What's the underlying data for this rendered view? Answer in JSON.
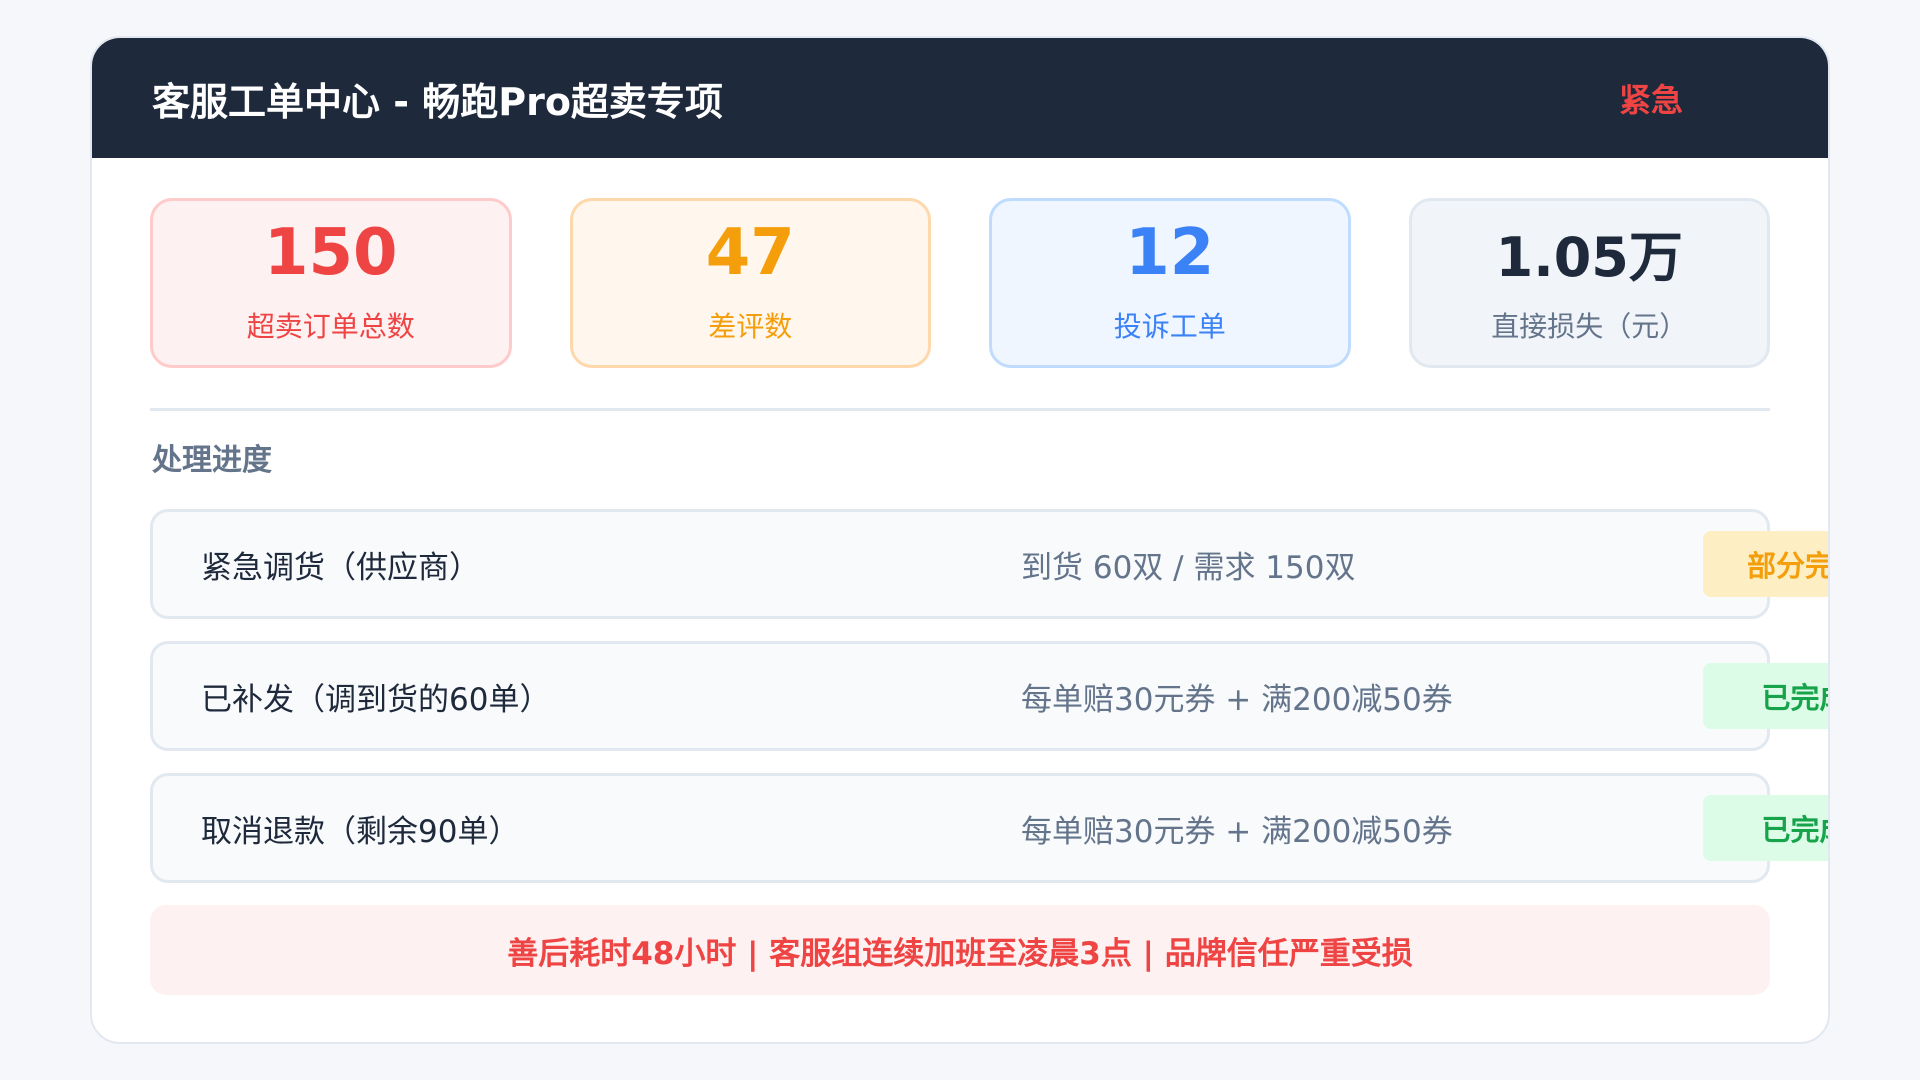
{
  "header": {
    "title": "客服工单中心 - 畅跑Pro超卖专项",
    "badge": "紧急"
  },
  "stats": [
    {
      "value": "150",
      "label": "超卖订单总数",
      "color": "#ef4444"
    },
    {
      "value": "47",
      "label": "差评数",
      "color": "#f59e0b"
    },
    {
      "value": "12",
      "label": "投诉工单",
      "color": "#3b82f6"
    },
    {
      "value": "1.05万",
      "label": "直接损失（元）",
      "color": "#1e293b"
    }
  ],
  "progress": {
    "title": "处理进度",
    "rows": [
      {
        "name": "紧急调货（供应商）",
        "detail": "到货 60双 / 需求 150双",
        "status": "部分完成",
        "status_color": "#f59e0b"
      },
      {
        "name": "已补发（调到货的60单）",
        "detail": "每单赔30元券 + 满200减50券",
        "status": "已完成",
        "status_color": "#16a34a"
      },
      {
        "name": "取消退款（剩余90单）",
        "detail": "每单赔30元券 + 满200减50券",
        "status": "已完成",
        "status_color": "#16a34a"
      }
    ]
  },
  "alert": {
    "text": "善后耗时48小时 | 客服组连续加班至凌晨3点 | 品牌信任严重受损"
  }
}
